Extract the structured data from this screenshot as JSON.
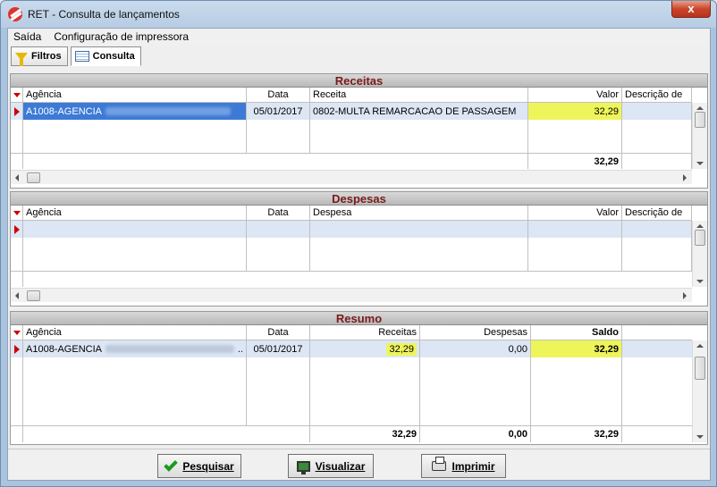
{
  "window": {
    "title": "RET - Consulta de lançamentos",
    "close_label": "x"
  },
  "menu": [
    "Saída",
    "Configuração de impressora"
  ],
  "tabs": [
    {
      "label": "Filtros",
      "icon": "funnel-icon"
    },
    {
      "label": "Consulta",
      "icon": "grid-icon",
      "active": true
    }
  ],
  "receitas": {
    "title": "Receitas",
    "columns": [
      "Agência",
      "Data",
      "Receita",
      "Valor",
      "Descrição de"
    ],
    "rows": [
      {
        "agencia": "A1008-AGENCIA",
        "data": "05/01/2017",
        "receita": "0802-MULTA REMARCACAO DE PASSAGEM",
        "valor": "32,29"
      }
    ],
    "total": "32,29"
  },
  "despesas": {
    "title": "Despesas",
    "columns": [
      "Agência",
      "Data",
      "Despesa",
      "Valor",
      "Descrição de"
    ]
  },
  "resumo": {
    "title": "Resumo",
    "columns": [
      "Agência",
      "Data",
      "Receitas",
      "Despesas",
      "Saldo"
    ],
    "rows": [
      {
        "agencia": "A1008-AGENCIA",
        "agencia_suffix": "..",
        "data": "05/01/2017",
        "receitas": "32,29",
        "despesas": "0,00",
        "saldo": "32,29"
      }
    ],
    "totals": {
      "receitas": "32,29",
      "despesas": "0,00",
      "saldo": "32,29"
    }
  },
  "buttons": {
    "pesquisar": "Pesquisar",
    "visualizar": "Visualizar",
    "imprimir": "Imprimir"
  },
  "colors": {
    "highlight": "#eef55a",
    "header_text": "#7b1a1a",
    "indicator": "#cc0000"
  }
}
